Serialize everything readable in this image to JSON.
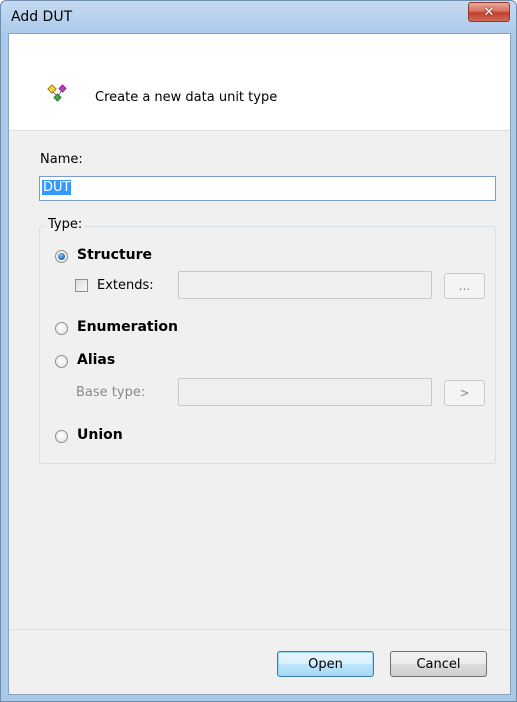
{
  "window": {
    "title": "Add DUT",
    "close_glyph": "✕"
  },
  "header": {
    "icon": "dut-type-icon",
    "description": "Create a new data unit type"
  },
  "name_field": {
    "label": "Name:",
    "value": "DUT"
  },
  "type_group": {
    "legend": "Type:",
    "options": [
      {
        "label": "Structure",
        "checked": true
      },
      {
        "label": "Enumeration",
        "checked": false
      },
      {
        "label": "Alias",
        "checked": false
      },
      {
        "label": "Union",
        "checked": false
      }
    ],
    "extends": {
      "label": "Extends:",
      "checked": false,
      "value": "",
      "browse_label": "..."
    },
    "base_type": {
      "label": "Base type:",
      "value": "",
      "browse_label": ">"
    }
  },
  "buttons": {
    "open": "Open",
    "cancel": "Cancel"
  },
  "colors": {
    "accent_selection": "#3399ff",
    "window_frame": "#aac8e8",
    "close_button": "#c0402d"
  }
}
